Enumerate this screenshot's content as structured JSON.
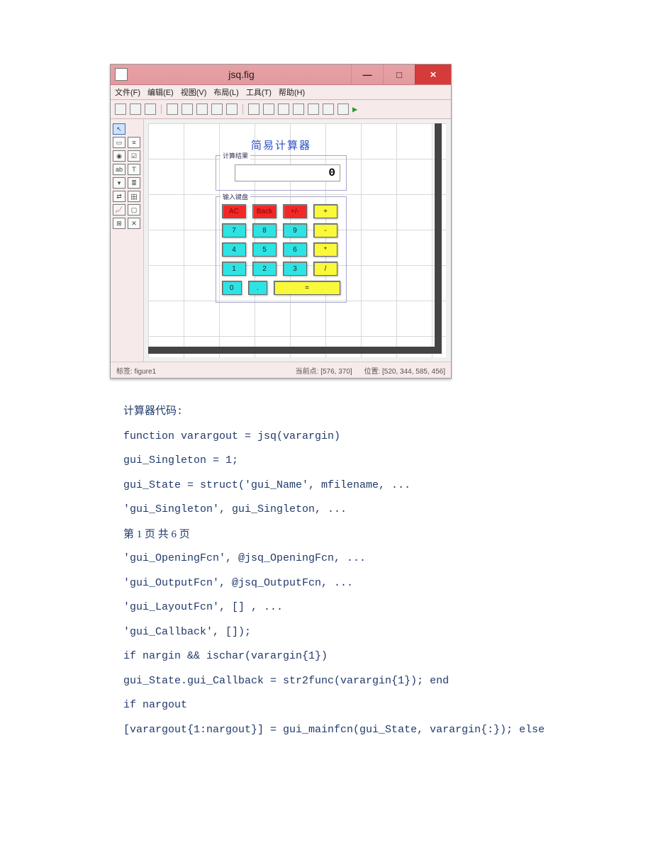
{
  "guide": {
    "title": "jsq.fig",
    "win": {
      "min": "—",
      "max": "□",
      "close": "×"
    },
    "menubar": [
      "文件(F)",
      "编辑(E)",
      "视图(V)",
      "布局(L)",
      "工具(T)",
      "帮助(H)"
    ],
    "status": {
      "left": "标签: figure1",
      "right1": "当前点: [576, 370]",
      "right2": "位置: [520, 344, 585, 456]"
    }
  },
  "calc": {
    "title": "简易计算器",
    "resultLegend": "计算结果",
    "resultValue": "0",
    "keypadLegend": "输入键盘",
    "rows": [
      [
        {
          "label": "AC",
          "cls": "red"
        },
        {
          "label": "Back",
          "cls": "red"
        },
        {
          "label": "+/-",
          "cls": "red"
        },
        {
          "label": "+",
          "cls": "yellow"
        }
      ],
      [
        {
          "label": "7",
          "cls": "cyan"
        },
        {
          "label": "8",
          "cls": "cyan"
        },
        {
          "label": "9",
          "cls": "cyan"
        },
        {
          "label": "-",
          "cls": "yellow"
        }
      ],
      [
        {
          "label": "4",
          "cls": "cyan"
        },
        {
          "label": "5",
          "cls": "cyan"
        },
        {
          "label": "6",
          "cls": "cyan"
        },
        {
          "label": "*",
          "cls": "yellow"
        }
      ],
      [
        {
          "label": "1",
          "cls": "cyan"
        },
        {
          "label": "2",
          "cls": "cyan"
        },
        {
          "label": "3",
          "cls": "cyan"
        },
        {
          "label": "/",
          "cls": "yellow"
        }
      ],
      [
        {
          "label": "0",
          "cls": "cyan"
        },
        {
          "label": ".",
          "cls": "cyan"
        },
        {
          "label": "=",
          "cls": "yellow",
          "wide": true
        }
      ]
    ]
  },
  "text": {
    "header": "计算器代码:",
    "pager": "第 1 页 共 6 页",
    "lines": [
      "function varargout = jsq(varargin)",
      "gui_Singleton = 1;",
      "gui_State = struct('gui_Name', mfilename, ...",
      "'gui_Singleton', gui_Singleton, ...",
      "__PAGER__",
      "'gui_OpeningFcn', @jsq_OpeningFcn, ...",
      "'gui_OutputFcn', @jsq_OutputFcn, ...",
      "'gui_LayoutFcn', [] , ...",
      "'gui_Callback', []);",
      "if nargin && ischar(varargin{1})",
      "gui_State.gui_Callback = str2func(varargin{1}); end",
      "if nargout",
      "[varargout{1:nargout}] = gui_mainfcn(gui_State, varargin{:}); else"
    ]
  }
}
